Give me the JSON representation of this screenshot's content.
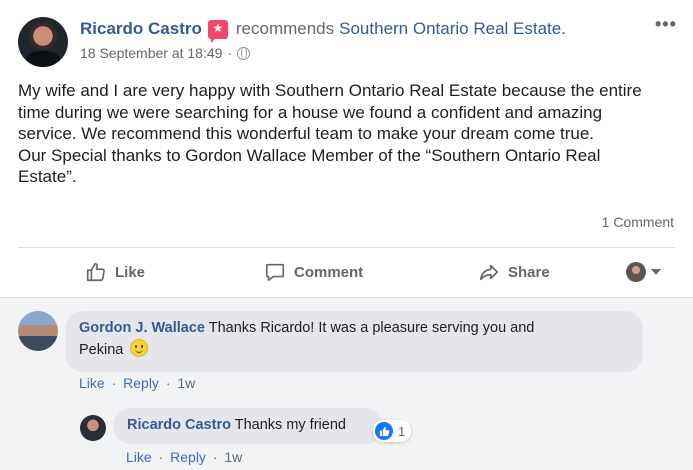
{
  "post": {
    "author": "Ricardo Castro",
    "badge_icon": "recommend-star-icon",
    "verb": "recommends",
    "page": "Southern Ontario Real Estate.",
    "timestamp": "18 September at 18:49",
    "separator": "·",
    "privacy_icon": "globe-icon",
    "more": "•••",
    "text_lines": [
      "My wife and I are very happy with Southern Ontario Real Estate because the entire",
      "time during we were searching for a house we found a confident and amazing",
      "service. We recommend this wonderful team to make your dream come true.",
      "Our Special thanks to Gordon Wallace Member of the “Southern Ontario Real",
      "Estate”."
    ],
    "comment_count": "1 Comment"
  },
  "actions": {
    "like": "Like",
    "comment": "Comment",
    "share": "Share"
  },
  "comments": [
    {
      "author": "Gordon J. Wallace",
      "text_line1": "Thanks Ricardo! It was a pleasure serving you and",
      "text_line2": "Pekina",
      "emoji": "smile-emoji",
      "like": "Like",
      "reply": "Reply",
      "time": "1w"
    }
  ],
  "reply": {
    "author": "Ricardo Castro",
    "text": "Thanks my friend",
    "reaction_count": "1",
    "like": "Like",
    "reply": "Reply",
    "time": "1w"
  },
  "colors": {
    "link": "#365899",
    "muted": "#606770",
    "badge": "#f2466b",
    "like_blue": "#1877f2",
    "comment_bg": "#f2f3f5"
  }
}
